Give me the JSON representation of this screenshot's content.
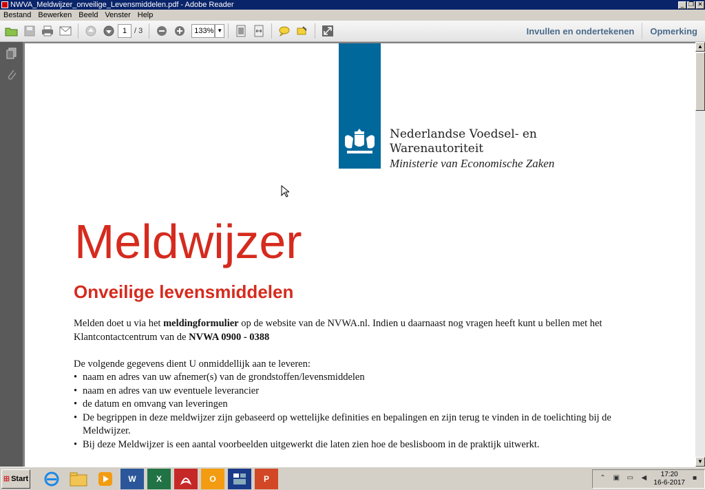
{
  "window": {
    "title": "NWVA_Meldwijzer_onveilige_Levensmiddelen.pdf - Adobe Reader",
    "minimize_glyph": "_",
    "restore_glyph": "❐",
    "close_glyph": "✕"
  },
  "menu": [
    "Bestand",
    "Bewerken",
    "Beeld",
    "Venster",
    "Help"
  ],
  "toolbar": {
    "page_current": "1",
    "page_total": "/ 3",
    "zoom": "133%",
    "fill_sign_label": "Invullen en ondertekenen",
    "comment_label": "Opmerking"
  },
  "document": {
    "org_line1": "Nederlandse Voedsel- en",
    "org_line2": "Warenautoriteit",
    "ministry": "Ministerie van Economische Zaken",
    "title": "Meldwijzer",
    "subtitle": "Onveilige levensmiddelen",
    "para1_a": "Melden doet u via het ",
    "para1_b": "meldingformulier",
    "para1_c": " op de website van de NVWA.nl. Indien u daarnaast nog vragen heeft kunt u bellen met het Klantcontactcentrum van de ",
    "para1_d": "NVWA 0900 - 0388",
    "para2": "De volgende gegevens dient U onmiddellijk aan te leveren:",
    "bullets": [
      "naam en adres van uw afnemer(s) van de grondstoffen/levensmiddelen",
      "naam en adres van uw eventuele leverancier",
      "de datum en omvang van leveringen",
      "De begrippen in deze meldwijzer zijn gebaseerd op wettelijke definities en bepalingen en zijn terug te vinden in de toelichting bij de Meldwijzer.",
      "Bij deze Meldwijzer is een aantal voorbeelden uitgewerkt die laten zien hoe de beslisboom in de praktijk uitwerkt."
    ]
  },
  "taskbar": {
    "start_label": "Start",
    "clock_time": "17:20",
    "clock_date": "16-6-2017"
  },
  "colors": {
    "accent_red": "#d52b1e",
    "rijks_blue": "#01689b"
  }
}
